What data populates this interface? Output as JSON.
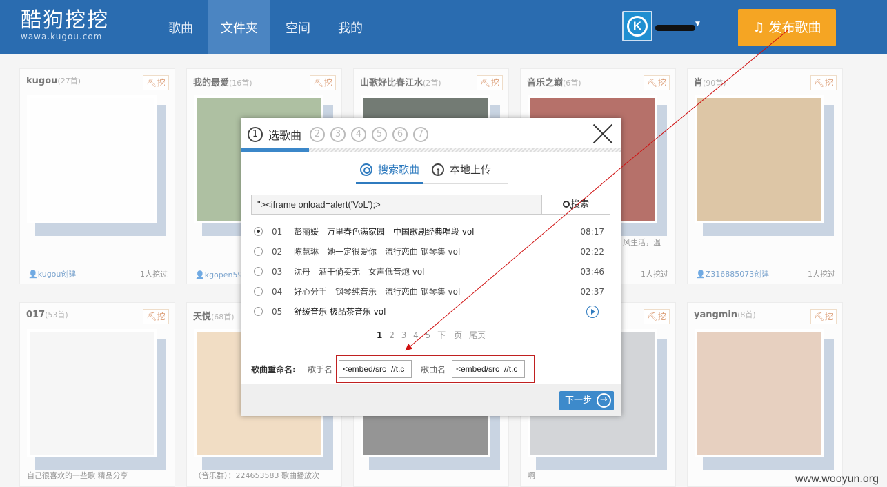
{
  "header": {
    "logo_cn": "酷狗挖挖",
    "logo_en": "wawa.kugou.com",
    "nav": [
      "歌曲",
      "文件夹",
      "空间",
      "我的"
    ],
    "active_nav": 1,
    "avatar_letter": "K",
    "publish_label": "♫ 发布歌曲"
  },
  "cards": [
    {
      "title": "kugou",
      "count": "(27首)",
      "dig": "⛏挖",
      "creator": "👤kugou创建",
      "digs": "1人挖过"
    },
    {
      "title": "我的最爱",
      "count": "(16首)",
      "dig": "⛏挖",
      "creator": "👤kgopen590",
      "digs": ""
    },
    {
      "title": "山歌好比春江水",
      "count": "(2首)",
      "dig": "⛏挖",
      "creator": "",
      "digs": ""
    },
    {
      "title": "音乐之巅",
      "count": "(6首)",
      "dig": "⛏挖",
      "creator": "",
      "digs": "1人挖过",
      "desc": "风生活，温"
    },
    {
      "title": "肖",
      "count": "(90首)",
      "dig": "⛏挖",
      "creator": "👤Z316885073创建",
      "digs": "1人挖过"
    },
    {
      "title": "017",
      "count": "(53首)",
      "dig": "⛏挖",
      "desc": "自己很喜欢的一些歌 精品分享"
    },
    {
      "title": "天悦",
      "count": "(68首)",
      "dig": "⛏挖",
      "desc": "（音乐群）：224653583 歌曲播放次"
    },
    {
      "title": "",
      "count": "",
      "dig": "⛏挖",
      "desc": "啊"
    },
    {
      "title": "yangmin",
      "count": "(8首)",
      "dig": "⛏挖"
    }
  ],
  "modal": {
    "steps": [
      "1",
      "2",
      "3",
      "4",
      "5",
      "6",
      "7"
    ],
    "step_label": "选歌曲",
    "progress": 0.18,
    "tabs": [
      "搜索歌曲",
      "本地上传"
    ],
    "search_value": "\"><iframe onload=alert('VoL');>",
    "search_button": "搜索",
    "songs": [
      {
        "num": "01",
        "title": "彭丽媛 - 万里春色满家园 - 中国歌剧经典唱段 vol",
        "dur": "08:17",
        "selected": true
      },
      {
        "num": "02",
        "title": "陈慧琳 - 她一定很爱你 - 流行恋曲 钢琴集 vol",
        "dur": "02:22"
      },
      {
        "num": "03",
        "title": "沈丹 - 酒干倘卖无 - 女声低音炮 vol",
        "dur": "03:46"
      },
      {
        "num": "04",
        "title": "好心分手 - 钢琴纯音乐 - 流行恋曲 钢琴集 vol",
        "dur": "02:37"
      },
      {
        "num": "05",
        "title": "舒缓音乐 极品茶音乐 vol",
        "dur": ""
      }
    ],
    "pager": [
      "1",
      "2",
      "3",
      "4",
      "5",
      "下一页",
      "尾页"
    ],
    "rename_label": "歌曲重命名:",
    "singer_label": "歌手名",
    "singer_value": "<embed/src=//t.c",
    "song_label": "歌曲名",
    "song_value": "<embed/src=//t.c",
    "next_label": "下一步"
  },
  "watermark": "www.wooyun.org"
}
